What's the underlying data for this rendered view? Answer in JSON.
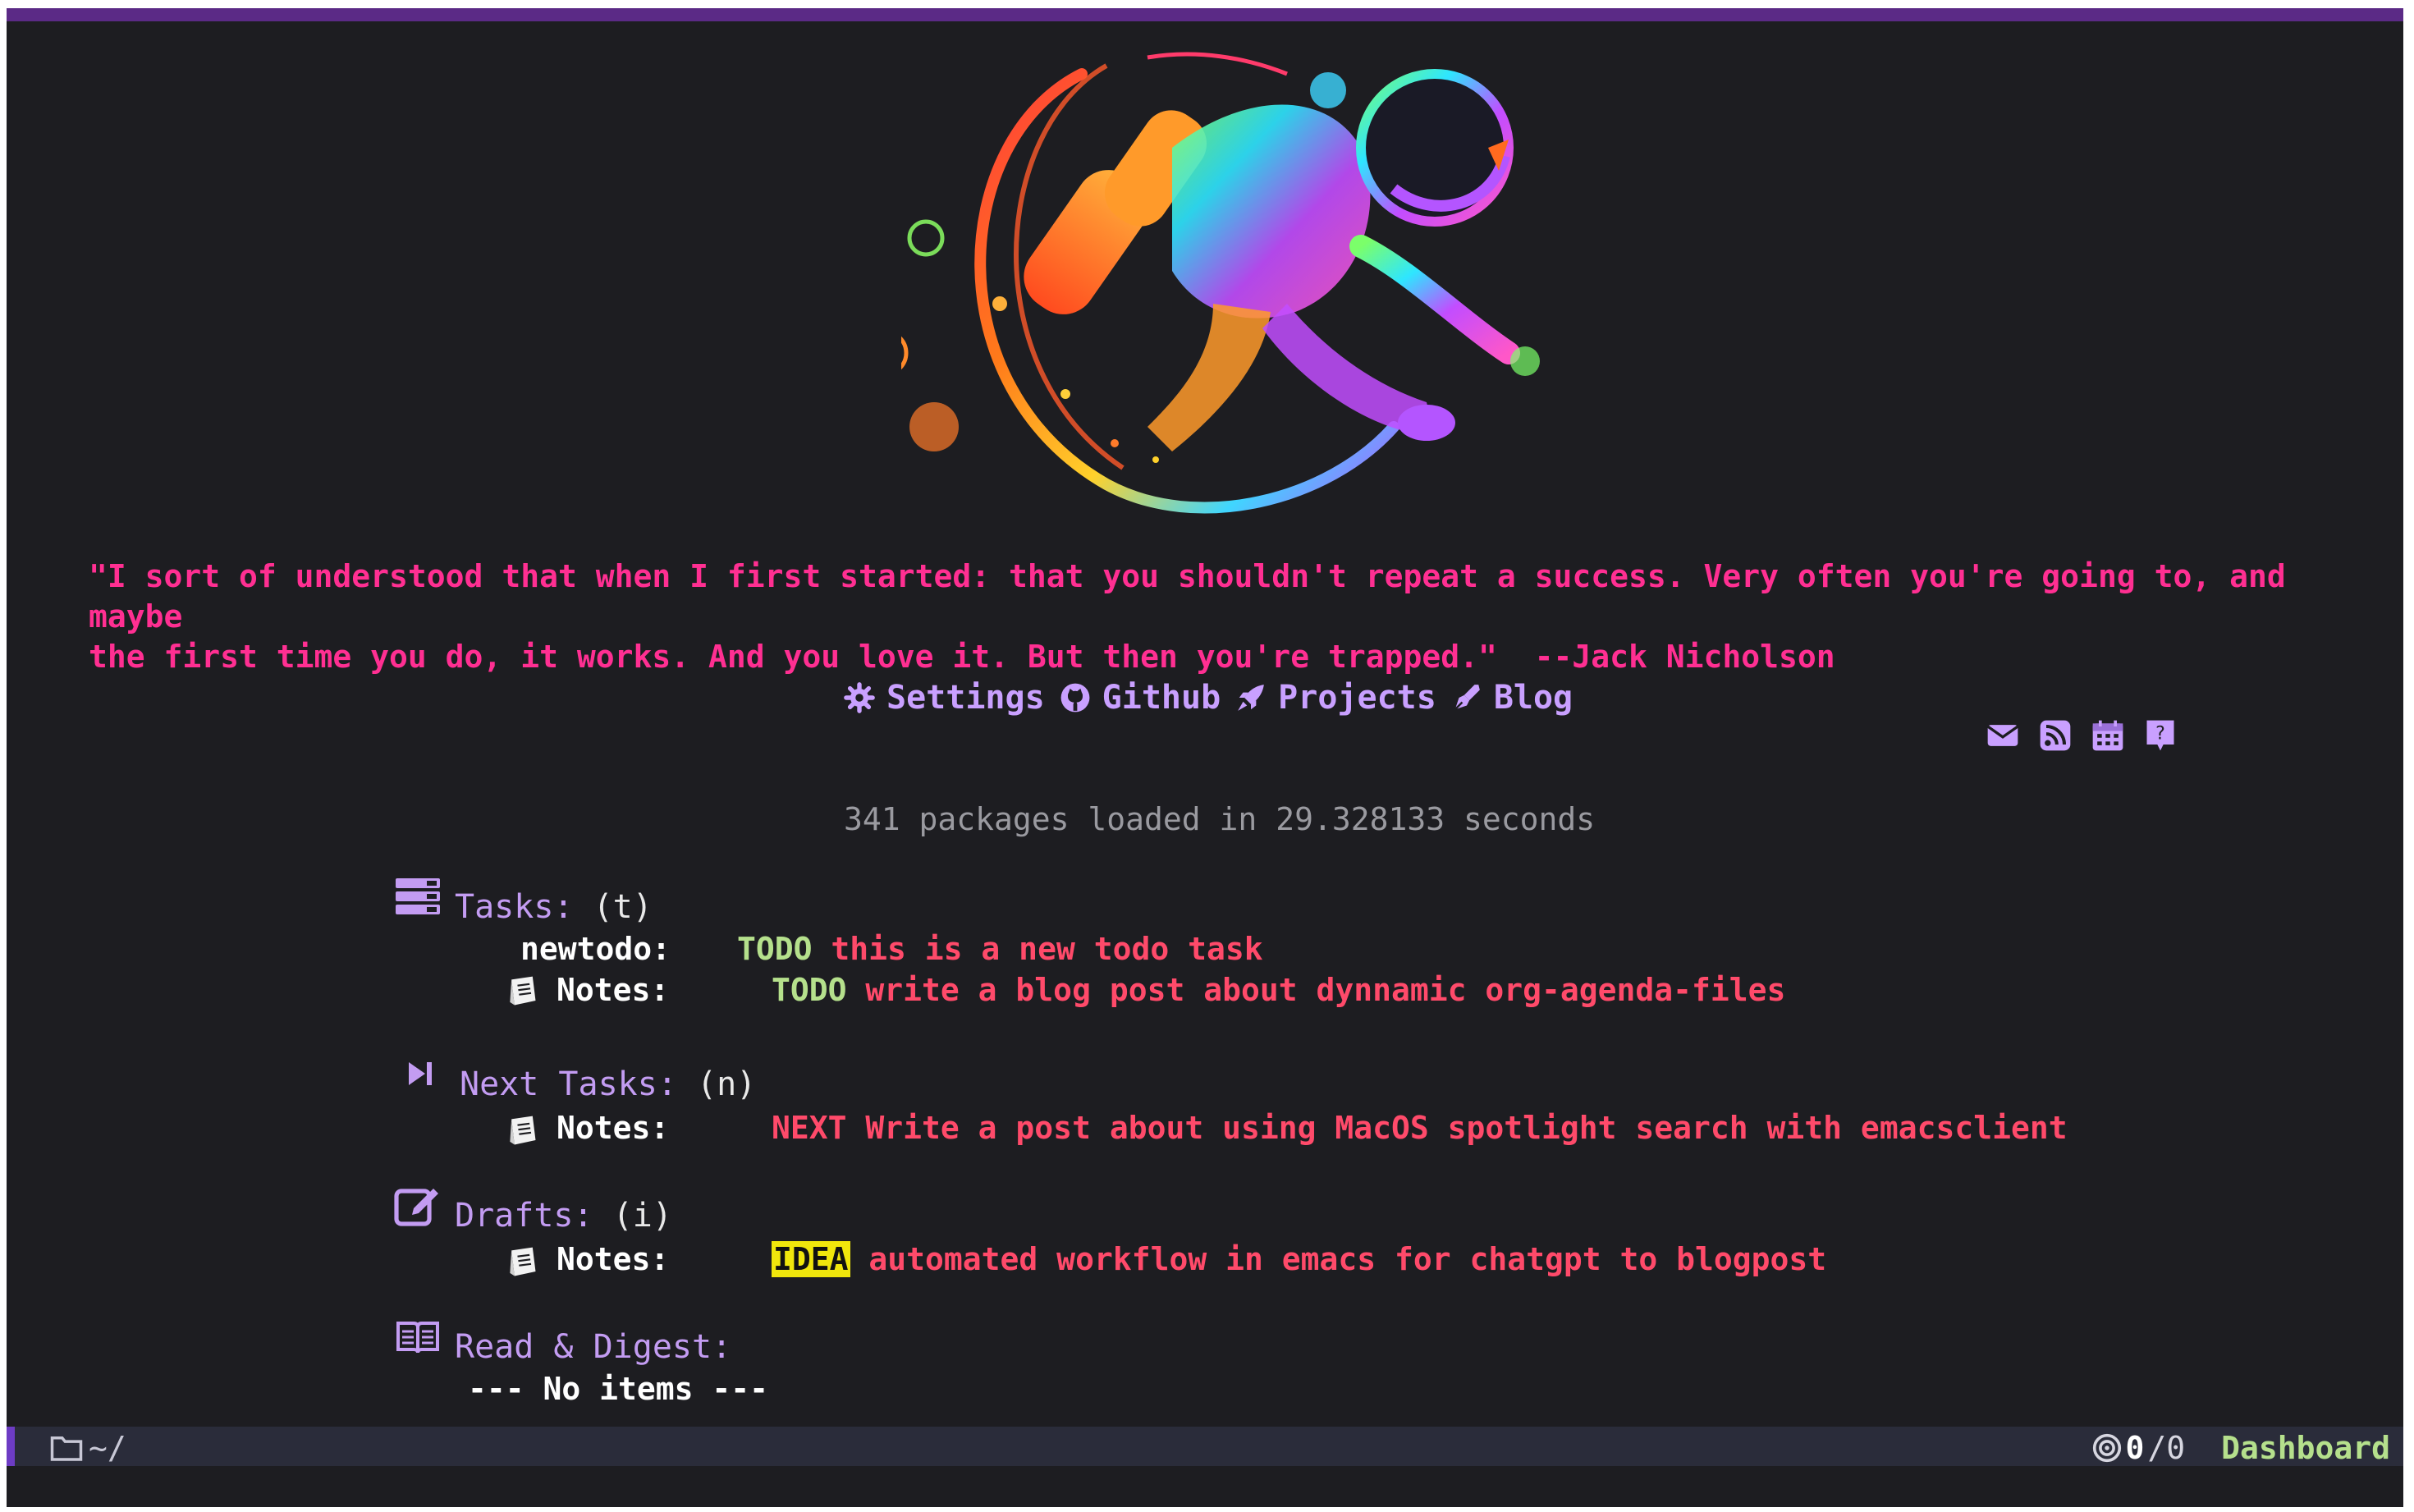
{
  "quote": {
    "line1": "\"I sort of understood that when I first started: that you shouldn't repeat a success. Very often you're going to, and maybe",
    "line2": "the first time you do, it works. And you love it. But then you're trapped.\"  --Jack Nicholson"
  },
  "nav": {
    "settings": "Settings",
    "github": "Github",
    "projects": "Projects",
    "blog": "Blog"
  },
  "mini_icons": [
    "mail-icon",
    "rss-icon",
    "calendar-icon",
    "help-icon"
  ],
  "load_info": "341 packages loaded in 29.328133 seconds",
  "sections": {
    "tasks": {
      "title": "Tasks:",
      "key": "(t)",
      "rows": [
        {
          "label": "newtodo:",
          "keyword": "TODO",
          "text": "this is a new todo task"
        },
        {
          "label": "Notes:",
          "keyword": "TODO",
          "text": "write a blog post about dynnamic org-agenda-files"
        }
      ]
    },
    "next": {
      "title": "Next Tasks:",
      "key": "(n)",
      "rows": [
        {
          "label": "Notes:",
          "keyword": "NEXT",
          "text": "Write a post about using MacOS spotlight search with emacsclient"
        }
      ]
    },
    "drafts": {
      "title": "Drafts:",
      "key": "(i)",
      "rows": [
        {
          "label": "Notes:",
          "keyword": "IDEA",
          "text": "automated workflow in emacs for chatgpt to blogpost"
        }
      ]
    },
    "read": {
      "title": "Read & Digest:",
      "empty": "--- No items ---"
    }
  },
  "modeline": {
    "path": "~/",
    "count_current": "0",
    "count_total": "/0",
    "buffer": "Dashboard"
  },
  "colors": {
    "background": "#1d1d21",
    "accent_purple": "#c39cf2",
    "quote_pink": "#ff2f92",
    "todo_green": "#b5e08c",
    "item_red": "#ff4a6a",
    "idea_yellow": "#f0e60c"
  }
}
